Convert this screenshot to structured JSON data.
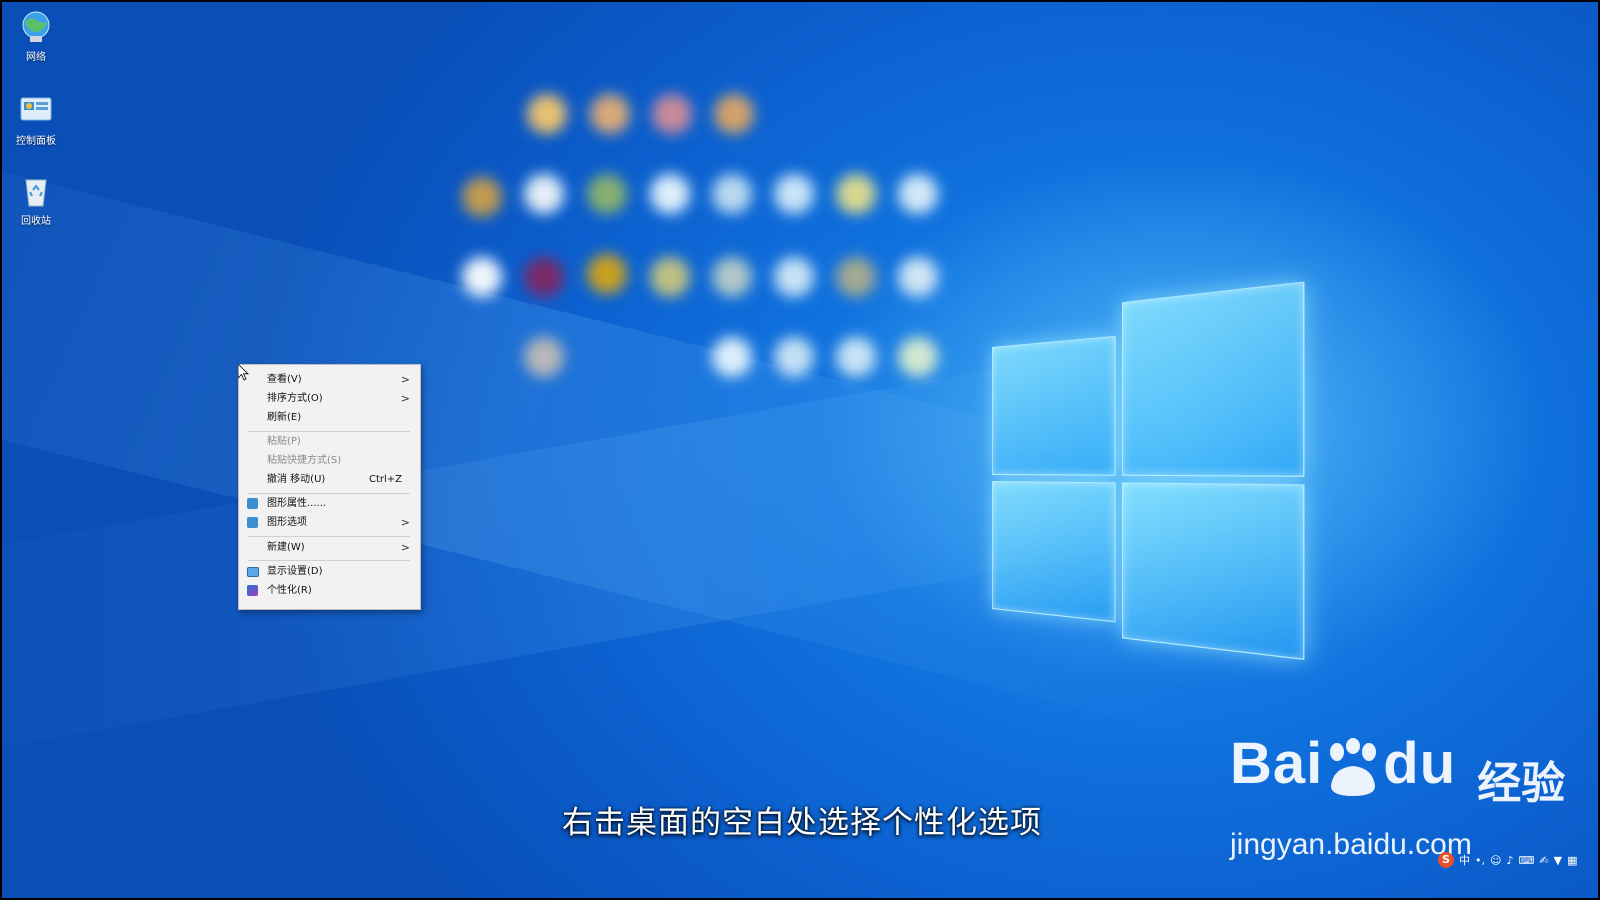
{
  "desktop": {
    "icons": [
      {
        "label": "网络",
        "icon": "network-icon"
      },
      {
        "label": "控制面板",
        "icon": "control-panel-icon"
      },
      {
        "label": "回收站",
        "icon": "recycle-bin-icon"
      }
    ]
  },
  "context_menu": {
    "view": "查看(V)",
    "sort": "排序方式(O)",
    "refresh": "刷新(E)",
    "paste": "粘贴(P)",
    "paste_shortcut": "粘贴快捷方式(S)",
    "undo_move": "撤消 移动(U)",
    "undo_shortcut": "Ctrl+Z",
    "graphics_properties": "图形属性......",
    "graphics_options": "图形选项",
    "new": "新建(W)",
    "display_settings": "显示设置(D)",
    "personalize": "个性化(R)",
    "submenu_arrow": ">"
  },
  "caption": "右击桌面的空白处选择个性化选项",
  "watermark": {
    "brand_left": "Bai",
    "brand_right": "du",
    "brand_cn": "经验",
    "url": "jingyan.baidu.com"
  },
  "tray": {
    "ime_mode": "中"
  },
  "colors": {
    "desktop_blue": "#0f6fdc",
    "menu_bg": "#f2f2f2"
  }
}
